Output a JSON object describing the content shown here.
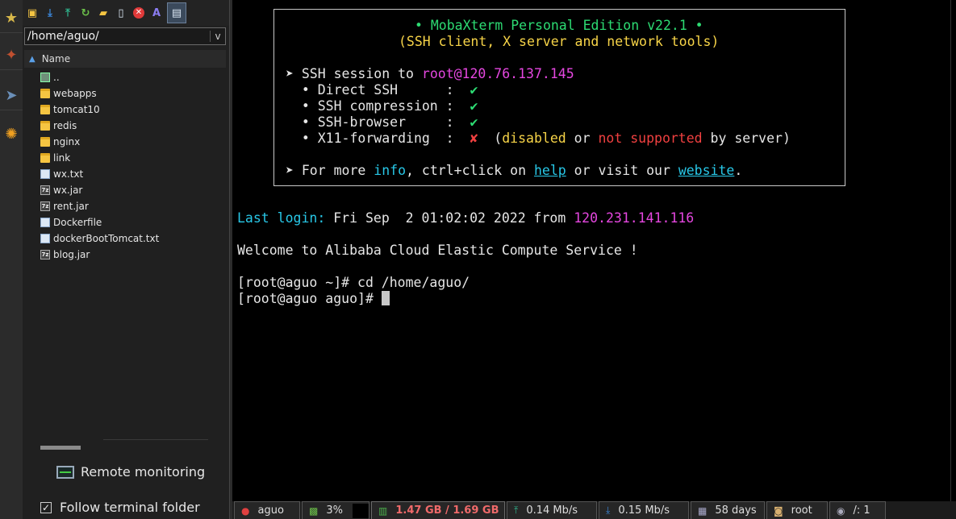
{
  "sidebar": {
    "icons": [
      "star-icon",
      "tools-icon",
      "send-icon",
      "macros-icon"
    ]
  },
  "browser": {
    "toolbar_icons": [
      "up-folder-icon",
      "download-icon",
      "upload-icon",
      "refresh-icon",
      "new-folder-icon",
      "new-file-icon",
      "delete-icon",
      "rename-icon",
      "terminal-folder-icon"
    ],
    "path": "/home/aguo/",
    "column_name": "Name",
    "files": [
      {
        "name": "..",
        "type": "parent"
      },
      {
        "name": "webapps",
        "type": "folder"
      },
      {
        "name": "tomcat10",
        "type": "folder"
      },
      {
        "name": "redis",
        "type": "folder"
      },
      {
        "name": "nginx",
        "type": "folder"
      },
      {
        "name": "link",
        "type": "folder"
      },
      {
        "name": "wx.txt",
        "type": "doc"
      },
      {
        "name": "wx.jar",
        "type": "jar"
      },
      {
        "name": "rent.jar",
        "type": "jar"
      },
      {
        "name": "Dockerfile",
        "type": "doc"
      },
      {
        "name": "dockerBootTomcat.txt",
        "type": "doc"
      },
      {
        "name": "blog.jar",
        "type": "jar"
      }
    ],
    "remote_monitoring": "Remote monitoring",
    "follow_terminal_folder": "Follow terminal folder",
    "follow_checked": true
  },
  "terminal": {
    "banner": {
      "title": "• MobaXterm Personal Edition v22.1 •",
      "subtitle": "(SSH client, X server and network tools)",
      "session_prefix": "➤ SSH session to ",
      "session_target": "root@120.76.137.145",
      "direct_ssh": "  • Direct SSH      :  ",
      "compression": "  • SSH compression :  ",
      "browser": "  • SSH-browser     :  ",
      "x11": "  • X11-forwarding  :  ",
      "check": "✔",
      "cross": "✘",
      "x11_note_open": "  (",
      "x11_disabled": "disabled",
      "x11_or": " or ",
      "x11_not_supported": "not supported",
      "x11_by_server": " by server)",
      "more_prefix": "➤ For more ",
      "more_info": "info",
      "more_mid": ", ctrl+click on ",
      "more_help": "help",
      "more_visit": " or visit our ",
      "more_website": "website",
      "more_end": "."
    },
    "last_login_label": "Last login:",
    "last_login_time": " Fri Sep  2 01:02:02 2022 from ",
    "last_login_ip": "120.231.141.116",
    "welcome": "Welcome to Alibaba Cloud Elastic Compute Service !",
    "cmd1": "[root@aguo ~]# cd /home/aguo/",
    "prompt2": "[root@aguo aguo]# "
  },
  "statusbar": {
    "host": "aguo",
    "cpu": "3%",
    "memory": "1.47 GB / 1.69 GB",
    "upload": "0.14 Mb/s",
    "download": "0.15 Mb/s",
    "uptime": "58 days",
    "user": "root",
    "disk": "/: 1"
  }
}
